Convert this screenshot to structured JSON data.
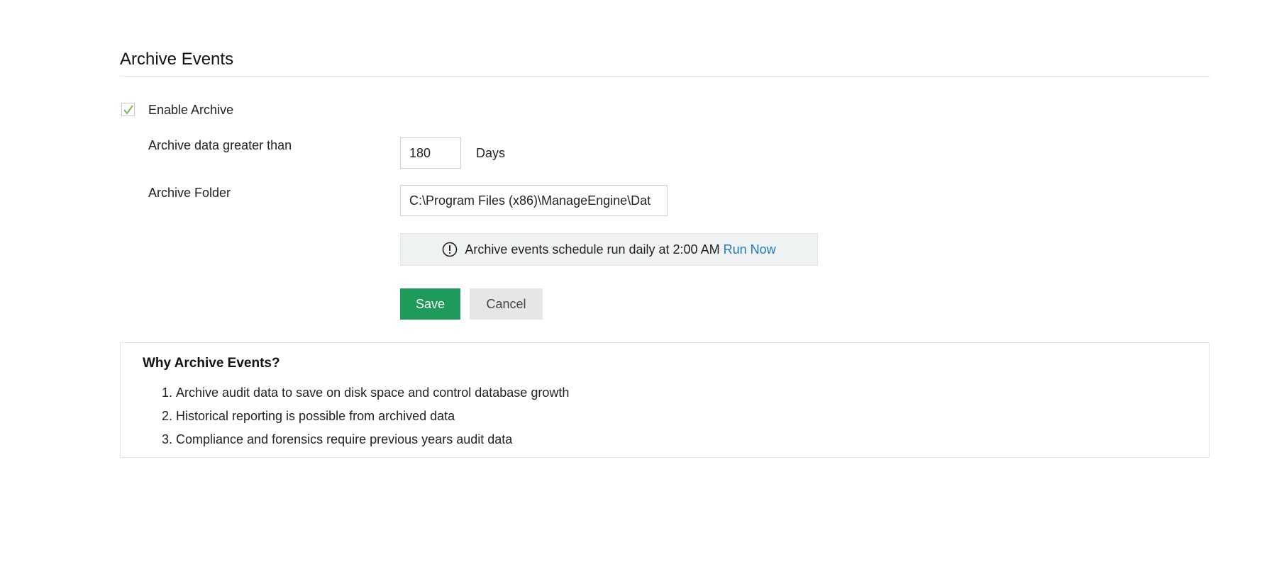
{
  "page": {
    "title": "Archive Events"
  },
  "form": {
    "enable_archive": {
      "label": "Enable Archive",
      "checked": true
    },
    "archive_days": {
      "label": "Archive data greater than",
      "value": "180",
      "unit": "Days"
    },
    "archive_folder": {
      "label": "Archive Folder",
      "value": "C:\\Program Files (x86)\\ManageEngine\\Dat"
    },
    "info": {
      "text": "Archive events schedule run daily at 2:00 AM",
      "link": "Run Now",
      "icon": "exclamation-circle-icon"
    },
    "save_label": "Save",
    "cancel_label": "Cancel"
  },
  "why": {
    "title": "Why Archive Events?",
    "items": [
      "Archive audit data to save on disk space and control database growth",
      "Historical reporting is possible from archived data",
      "Compliance and forensics require previous years audit data"
    ]
  },
  "colors": {
    "accent": "#1e9a5a",
    "link": "#1f7bc1",
    "check": "#7cb856"
  }
}
